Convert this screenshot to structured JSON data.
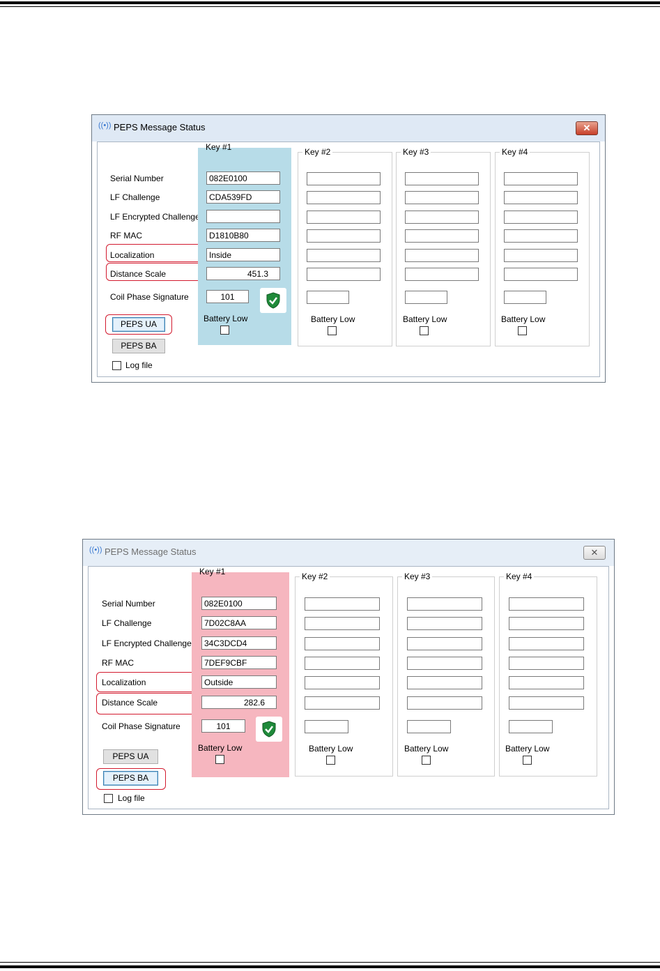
{
  "windows": [
    {
      "title": "PEPS Message Status",
      "close_glyph": "✕",
      "title_icon": "signal-icon",
      "labels": {
        "serial_number": "Serial Number",
        "lf_challenge": "LF Challenge",
        "lf_encrypted_challenge": "LF Encrypted Challenge",
        "rf_mac": "RF MAC",
        "localization": "Localization",
        "distance_scale": "Distance Scale",
        "coil_phase_signature": "Coil Phase Signature"
      },
      "keys": [
        {
          "label": "Key #1",
          "serial_number": "082E0100",
          "lf_challenge": "CDA539FD",
          "lf_encrypted_challenge": "",
          "rf_mac": "D1810B80",
          "localization": "Inside",
          "distance_scale": "451.3",
          "coil_phase_signature": "101",
          "battery_low": "Battery Low",
          "battery_low_checked": false
        },
        {
          "label": "Key #2",
          "serial_number": "",
          "lf_challenge": "",
          "lf_encrypted_challenge": "",
          "rf_mac": "",
          "localization": "",
          "distance_scale": "",
          "coil_phase_signature": "",
          "battery_low": "Battery Low",
          "battery_low_checked": false
        },
        {
          "label": "Key #3",
          "serial_number": "",
          "lf_challenge": "",
          "lf_encrypted_challenge": "",
          "rf_mac": "",
          "localization": "",
          "distance_scale": "",
          "coil_phase_signature": "",
          "battery_low": "Battery Low",
          "battery_low_checked": false
        },
        {
          "label": "Key #4",
          "serial_number": "",
          "lf_challenge": "",
          "lf_encrypted_challenge": "",
          "rf_mac": "",
          "localization": "",
          "distance_scale": "",
          "coil_phase_signature": "",
          "battery_low": "Battery Low",
          "battery_low_checked": false
        }
      ],
      "buttons": {
        "peps_ua": "PEPS UA",
        "peps_ba": "PEPS BA"
      },
      "log_file": "Log file",
      "log_file_checked": false,
      "status_icon": "shield-check-icon",
      "focused_button": "peps_ua",
      "key1_highlight_color": "#b7dce8"
    },
    {
      "title": "PEPS Message Status",
      "close_glyph": "✕",
      "title_icon": "signal-icon",
      "labels": {
        "serial_number": "Serial Number",
        "lf_challenge": "LF Challenge",
        "lf_encrypted_challenge": "LF Encrypted Challenge",
        "rf_mac": "RF MAC",
        "localization": "Localization",
        "distance_scale": "Distance Scale",
        "coil_phase_signature": "Coil Phase Signature"
      },
      "keys": [
        {
          "label": "Key #1",
          "serial_number": "082E0100",
          "lf_challenge": "7D02C8AA",
          "lf_encrypted_challenge": "34C3DCD4",
          "rf_mac": "7DEF9CBF",
          "localization": "Outside",
          "distance_scale": "282.6",
          "coil_phase_signature": "101",
          "battery_low": "Battery Low",
          "battery_low_checked": false
        },
        {
          "label": "Key #2",
          "serial_number": "",
          "lf_challenge": "",
          "lf_encrypted_challenge": "",
          "rf_mac": "",
          "localization": "",
          "distance_scale": "",
          "coil_phase_signature": "",
          "battery_low": "Battery Low",
          "battery_low_checked": false
        },
        {
          "label": "Key #3",
          "serial_number": "",
          "lf_challenge": "",
          "lf_encrypted_challenge": "",
          "rf_mac": "",
          "localization": "",
          "distance_scale": "",
          "coil_phase_signature": "",
          "battery_low": "Battery Low",
          "battery_low_checked": false
        },
        {
          "label": "Key #4",
          "serial_number": "",
          "lf_challenge": "",
          "lf_encrypted_challenge": "",
          "rf_mac": "",
          "localization": "",
          "distance_scale": "",
          "coil_phase_signature": "",
          "battery_low": "Battery Low",
          "battery_low_checked": false
        }
      ],
      "buttons": {
        "peps_ua": "PEPS UA",
        "peps_ba": "PEPS BA"
      },
      "log_file": "Log file",
      "log_file_checked": false,
      "status_icon": "shield-check-icon",
      "focused_button": "peps_ba",
      "key1_highlight_color": "#f6b6bf"
    }
  ],
  "annotation_color": "#d21a2e"
}
